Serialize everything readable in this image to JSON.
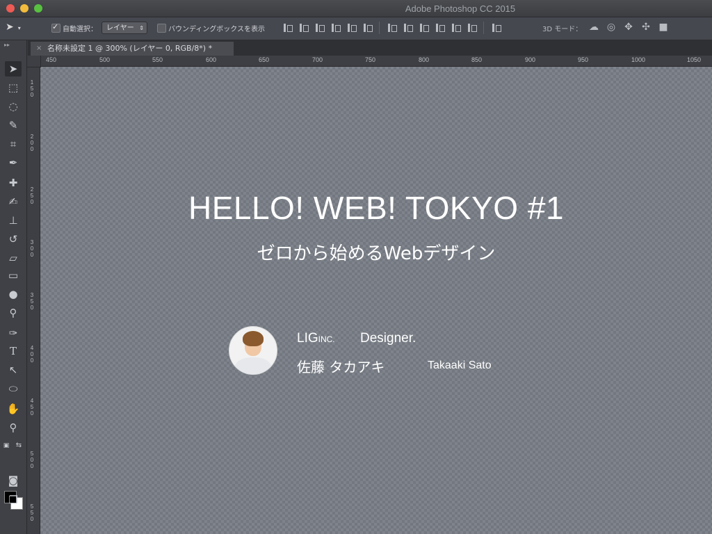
{
  "window": {
    "title": "Adobe Photoshop CC 2015"
  },
  "options_bar": {
    "auto_select_label": "自動選択：",
    "auto_select_checked": true,
    "auto_select_target": "レイヤー",
    "bounding_box_label": "バウンディングボックスを表示",
    "bounding_box_checked": false,
    "mode_3d_label": "3D モード："
  },
  "document_tab": {
    "title": "名称未設定 1 @ 300% (レイヤー 0, RGB/8*) *",
    "close_glyph": "×"
  },
  "ruler": {
    "top_ticks": [
      "450",
      "500",
      "550",
      "600",
      "650",
      "700",
      "750",
      "800",
      "850",
      "900",
      "950",
      "1000",
      "1050"
    ],
    "left_ticks": [
      "150",
      "200",
      "250",
      "300",
      "350",
      "400",
      "450",
      "500",
      "550"
    ]
  },
  "toolbar": {
    "tools": [
      "move-tool",
      "marquee-tool",
      "lasso-tool",
      "quick-select-tool",
      "crop-tool",
      "eyedropper-tool",
      "healing-brush-tool",
      "brush-tool",
      "clone-stamp-tool",
      "history-brush-tool",
      "eraser-tool",
      "gradient-tool",
      "blur-tool",
      "dodge-tool",
      "pen-tool",
      "type-tool",
      "path-select-tool",
      "ellipse-tool",
      "hand-tool",
      "zoom-tool"
    ],
    "foreground_color": "#000000",
    "background_color": "#ffffff"
  },
  "canvas": {
    "headline": "HELLO! WEB! TOKYO #1",
    "subline": "ゼロから始めるWebデザイン",
    "company_main": "LIG",
    "company_suffix": "INC.",
    "role": "Designer.",
    "name_jp": "佐藤 タカアキ",
    "name_en": "Takaaki Sato"
  }
}
